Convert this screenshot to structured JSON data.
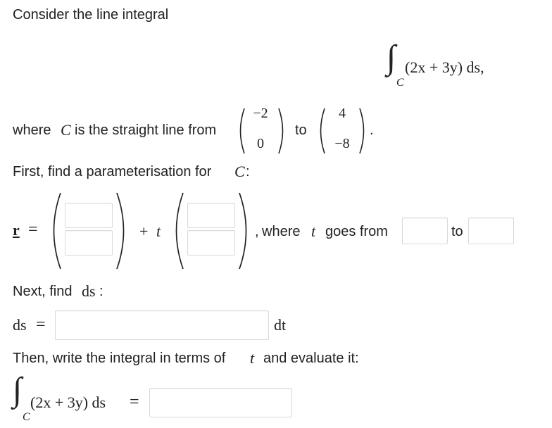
{
  "intro": "Consider the line integral",
  "display_integral": {
    "sign": "∫",
    "subscript": "C",
    "integrand": "(2x + 3y) ds,"
  },
  "line_sentence": {
    "prefix": "where",
    "curve": "C",
    "middle": "is the straight line from",
    "start_point": {
      "top": "−2",
      "bottom": "0"
    },
    "connector": "to",
    "end_point": {
      "top": "4",
      "bottom": "−8"
    },
    "end": "."
  },
  "step1": {
    "text": "First, find a parameterisation for",
    "var": "C",
    "colon": ":"
  },
  "param": {
    "r_label": "r",
    "equals": "=",
    "plus": "+",
    "t": "t",
    "comma": ",",
    "where": "where",
    "goes_from": "goes from",
    "to": "to",
    "inputs": {
      "r0_top": "",
      "r0_bottom": "",
      "dir_top": "",
      "dir_bottom": "",
      "t_start": "",
      "t_end": ""
    }
  },
  "step2": {
    "text": "Next, find",
    "ds": "ds",
    "colon": ":"
  },
  "ds_row": {
    "label": "ds",
    "equals": "=",
    "value": "",
    "dt": "dt"
  },
  "step3": {
    "before": "Then, write the integral in terms of",
    "t": "t",
    "after": "and evaluate it:"
  },
  "final_integral": {
    "sign": "∫",
    "subscript": "C",
    "integrand": "(2x + 3y) ds",
    "equals": "=",
    "value": ""
  }
}
